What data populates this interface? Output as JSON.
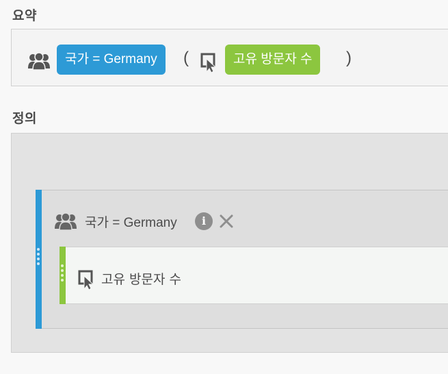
{
  "summary": {
    "title": "요약",
    "dimension_pill": "국가 = Germany",
    "open_paren": "(",
    "metric_pill": "고유 방문자 수",
    "close_paren": ")"
  },
  "definition": {
    "title": "정의",
    "container_label": "국가 = Germany",
    "info_icon_glyph": "i",
    "metric_label": "고유 방문자 수"
  },
  "colors": {
    "dimension_accent": "#2d9ad6",
    "metric_accent": "#8cc63f"
  },
  "icons": {
    "visitors": "visitors-icon",
    "cursor": "cursor-icon",
    "info": "info-icon",
    "close": "close-icon"
  }
}
